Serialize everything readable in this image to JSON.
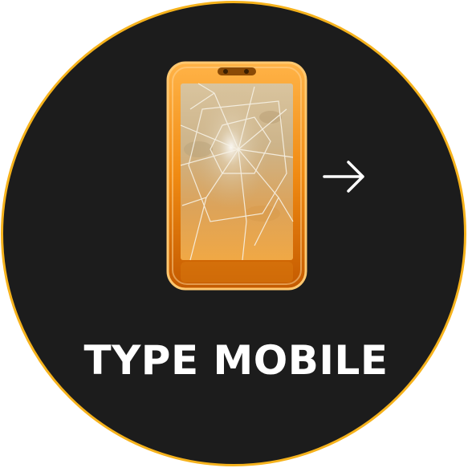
{
  "tile": {
    "label": "TYPE MOBILE",
    "image_subject": "cracked-phone-icon",
    "action_icon": "arrow-right-icon"
  },
  "colors": {
    "background": "#1c1c1c",
    "ring": "#f5b21c",
    "label": "#ffffff",
    "phone_body": "#f08a12"
  }
}
